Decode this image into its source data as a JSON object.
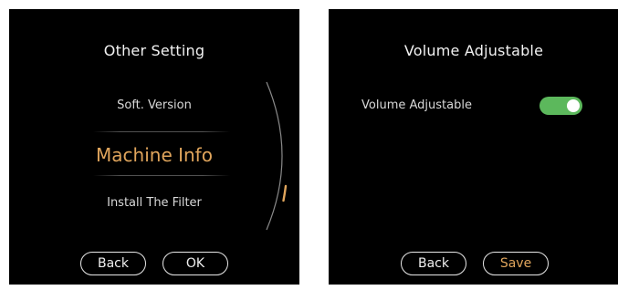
{
  "left_screen": {
    "title": "Other Setting",
    "menu": {
      "items": [
        {
          "label": "Soft. Version"
        },
        {
          "label": "Machine Info"
        },
        {
          "label": "Install The Filter"
        }
      ],
      "selected_index": 1
    },
    "buttons": {
      "back_label": "Back",
      "ok_label": "OK"
    }
  },
  "right_screen": {
    "title": "Volume Adjustable",
    "setting": {
      "label": "Volume Adjustable",
      "toggle_on": true
    },
    "buttons": {
      "back_label": "Back",
      "save_label": "Save"
    }
  },
  "colors": {
    "screen_background": "#000000",
    "selected_text": "#e0a55c",
    "toggle_on": "#5cb85c",
    "button_border": "#e8e8e8"
  }
}
